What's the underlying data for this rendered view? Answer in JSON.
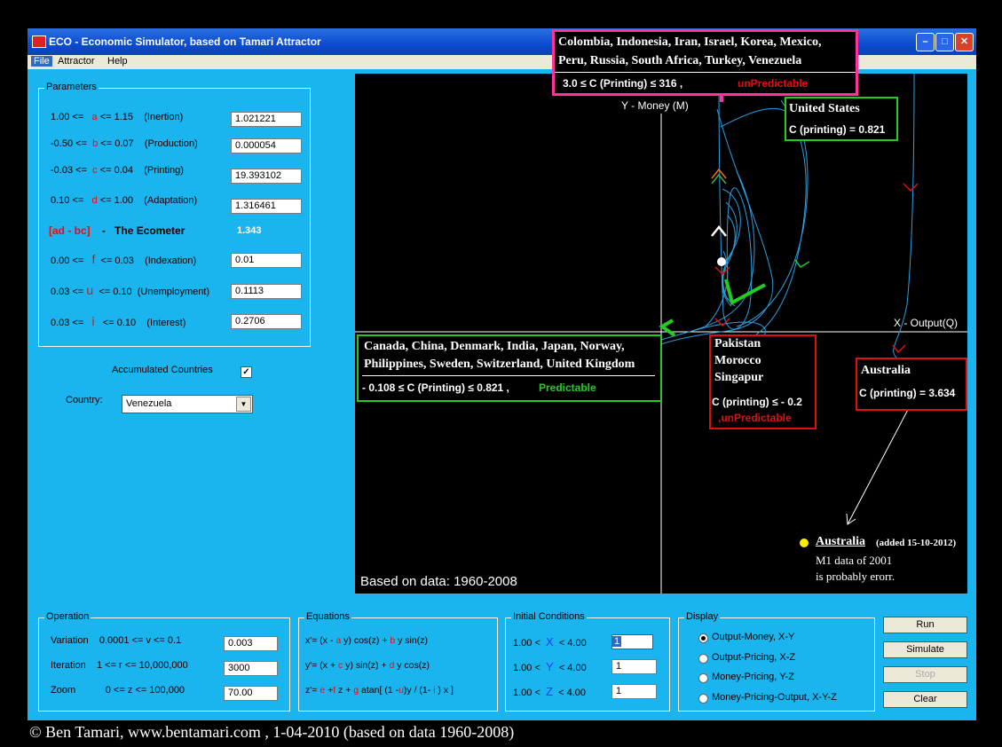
{
  "title": "ECO - Economic Simulator, based on Tamari Attractor",
  "menu": [
    "File",
    "Attractor",
    "Help"
  ],
  "parameters": {
    "legend": "Parameters",
    "a": {
      "range_lo": "1.00 <=",
      "var": "a",
      "range_hi": "<= 1.15",
      "desc": "(Inertion)",
      "value": "1.021221"
    },
    "b": {
      "range_lo": "-0.50 <=",
      "var": "b",
      "range_hi": "<= 0.07",
      "desc": "(Production)",
      "value": "0.000054"
    },
    "c": {
      "range_lo": "-0.03 <=",
      "var": "c",
      "range_hi": "<= 0.04",
      "desc": "(Printing)",
      "value": "19.393102"
    },
    "d": {
      "range_lo": "0.10 <=",
      "var": "d",
      "range_hi": "<= 1.00",
      "desc": "(Adaptation)",
      "value": "1.316461"
    },
    "ecometer": {
      "formula": "[ad - bc]",
      "dash": "-",
      "label": "The Ecometer",
      "value": "1.343"
    },
    "f": {
      "range_lo": "0.00 <=",
      "var": "f",
      "range_hi": "<= 0.03",
      "desc": "(Indexation)",
      "value": "0.01"
    },
    "u": {
      "range_lo": "0.03 <=",
      "var": "u",
      "range_hi": "<= 0.10",
      "desc": "(Unemployment)",
      "value": "0.1113"
    },
    "i": {
      "range_lo": "0.03 <=",
      "var": "i",
      "range_hi": "<= 0.10",
      "desc": "(Interest)",
      "value": "0.2706"
    }
  },
  "accumulated": {
    "label": "Accumulated Countries",
    "checked": true
  },
  "country": {
    "label": "Country:",
    "selected": "Venezuela"
  },
  "plot": {
    "y_axis": "Y - Money (M)",
    "x_axis": "X - Output(Q)",
    "based_on": "Based on data: 1960-2008",
    "top_box": {
      "line1": "Colombia, Indonesia, Iran, Israel, Korea, Mexico,",
      "line2": "Peru, Russia, South Africa, Turkey, Venezuela",
      "range": "3.0 ≤  C (Printing) ≤ 316  ,",
      "status": "unPredictable"
    },
    "us_box": {
      "name": "United States",
      "value": "C (printing) = 0.821"
    },
    "green_box": {
      "line1": "Canada, China, Denmark, India, Japan, Norway,",
      "line2": "Philippines, Sweden, Switzerland, United Kingdom",
      "range": "- 0.108 ≤ C (Printing) ≤  0.821  ,",
      "status": "Predictable"
    },
    "pak_box": {
      "c1": "Pakistan",
      "c2": "Morocco",
      "c3": "Singapur",
      "range": "C (printing) ≤ - 0.2",
      "status": ",unPredictable"
    },
    "aus_box": {
      "name": "Australia",
      "value": "C (printing) = 3.634"
    },
    "note": {
      "name": "Australia",
      "added": "(added 15-10-2012)",
      "line1": "M1 data of 2001",
      "line2": "is probably erorr."
    }
  },
  "operation": {
    "legend": "Operation",
    "variation": {
      "label": "Variation",
      "range": "0.0001 <= v <= 0.1",
      "value": "0.003"
    },
    "iteration": {
      "label": "Iteration",
      "range": "1 <= r <= 10,000,000",
      "value": "3000"
    },
    "zoom": {
      "label": "Zoom",
      "range": "0 <= z <= 100,000",
      "value": "70.00"
    }
  },
  "equations": {
    "legend": "Equations"
  },
  "initial": {
    "legend": "Initial Conditions",
    "x": {
      "lo": "1.00 <",
      "var": "X",
      "hi": "< 4.00",
      "value": "1"
    },
    "y": {
      "lo": "1.00 <",
      "var": "Y",
      "hi": "< 4.00",
      "value": "1"
    },
    "z": {
      "lo": "1.00 <",
      "var": "Z",
      "hi": "< 4.00",
      "value": "1"
    }
  },
  "display": {
    "legend": "Display",
    "options": [
      "Output-Money,  X-Y",
      "Output-Pricing,  X-Z",
      "Money-Pricing,  Y-Z",
      "Money-Pricing-Output,  X-Y-Z"
    ]
  },
  "buttons": {
    "run": "Run",
    "simulate": "Simulate",
    "stop": "Stop",
    "clear": "Clear"
  },
  "footer": "©  Ben Tamari,   www.bentamari.com , 1-04-2010 (based on data 1960-2008)",
  "colors": {
    "window_bg": "#1ab4ee",
    "plot_bg": "#000000",
    "magenta": "#ff3399",
    "green": "#22cc22",
    "red": "#e01010"
  }
}
